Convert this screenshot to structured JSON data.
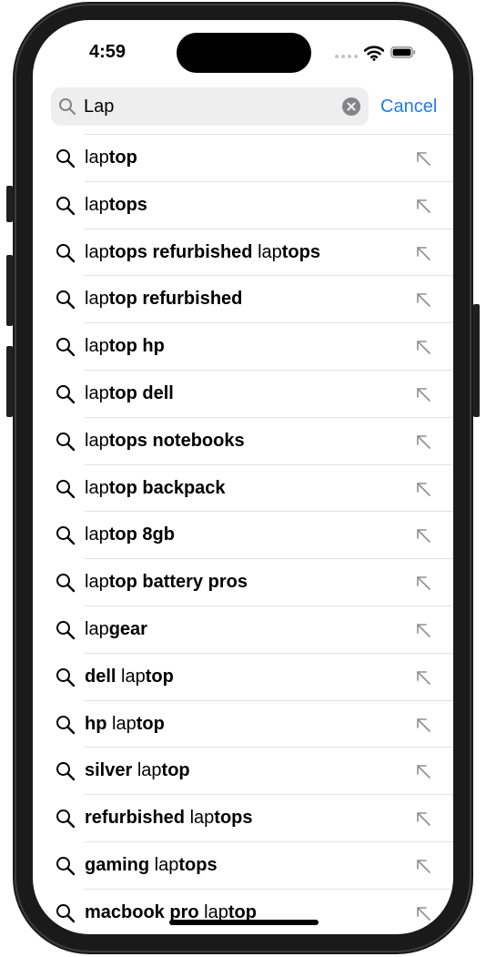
{
  "status_bar": {
    "time": "4:59"
  },
  "search": {
    "query": "Lap",
    "cancel_label": "Cancel"
  },
  "colors": {
    "accent": "#1e7cf2",
    "search_field_bg": "#eeeeef",
    "separator": "#e2e2e4"
  },
  "icons": {
    "search": "magnifier-icon",
    "fill": "arrow-up-left-icon",
    "clear": "x-circle-icon"
  },
  "suggestions": [
    {
      "parts": [
        [
          "lap",
          false
        ],
        [
          "top",
          true
        ]
      ]
    },
    {
      "parts": [
        [
          "lap",
          false
        ],
        [
          "tops",
          true
        ]
      ]
    },
    {
      "parts": [
        [
          "lap",
          false
        ],
        [
          "tops refurbished ",
          true
        ],
        [
          "lap",
          false
        ],
        [
          "tops",
          true
        ]
      ]
    },
    {
      "parts": [
        [
          "lap",
          false
        ],
        [
          "top refurbished",
          true
        ]
      ]
    },
    {
      "parts": [
        [
          "lap",
          false
        ],
        [
          "top hp",
          true
        ]
      ]
    },
    {
      "parts": [
        [
          "lap",
          false
        ],
        [
          "top dell",
          true
        ]
      ]
    },
    {
      "parts": [
        [
          "lap",
          false
        ],
        [
          "tops notebooks",
          true
        ]
      ]
    },
    {
      "parts": [
        [
          "lap",
          false
        ],
        [
          "top backpack",
          true
        ]
      ]
    },
    {
      "parts": [
        [
          "lap",
          false
        ],
        [
          "top 8gb",
          true
        ]
      ]
    },
    {
      "parts": [
        [
          "lap",
          false
        ],
        [
          "top battery pros",
          true
        ]
      ]
    },
    {
      "parts": [
        [
          "lap",
          false
        ],
        [
          "gear",
          true
        ]
      ]
    },
    {
      "parts": [
        [
          "dell ",
          true
        ],
        [
          "lap",
          false
        ],
        [
          "top",
          true
        ]
      ]
    },
    {
      "parts": [
        [
          "hp ",
          true
        ],
        [
          "lap",
          false
        ],
        [
          "top",
          true
        ]
      ]
    },
    {
      "parts": [
        [
          "silver ",
          true
        ],
        [
          "lap",
          false
        ],
        [
          "top",
          true
        ]
      ]
    },
    {
      "parts": [
        [
          "refurbished ",
          true
        ],
        [
          "lap",
          false
        ],
        [
          "tops",
          true
        ]
      ]
    },
    {
      "parts": [
        [
          "gaming ",
          true
        ],
        [
          "lap",
          false
        ],
        [
          "tops",
          true
        ]
      ]
    },
    {
      "parts": [
        [
          "macbook pro ",
          true
        ],
        [
          "lap",
          false
        ],
        [
          "top",
          true
        ]
      ]
    }
  ]
}
